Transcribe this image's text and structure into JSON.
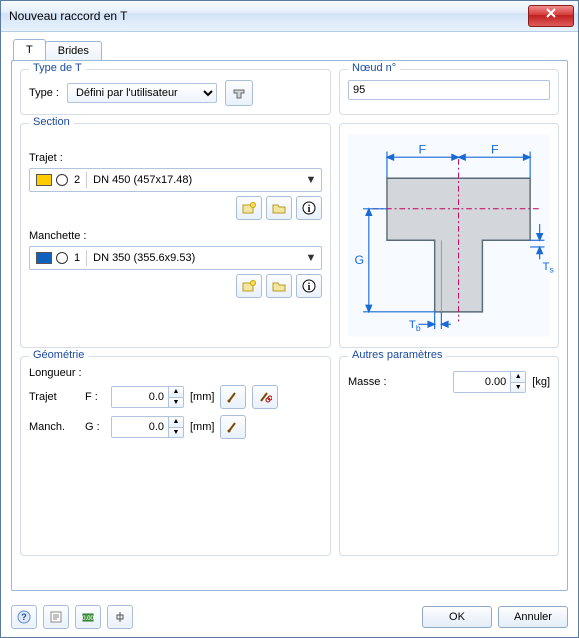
{
  "window": {
    "title": "Nouveau raccord en T"
  },
  "tabs": {
    "t": "T",
    "brides": "Brides"
  },
  "type_group": {
    "legend": "Type de T",
    "label": "Type :",
    "selected": "Défini par l'utilisateur"
  },
  "node_group": {
    "legend": "Nœud n°",
    "value": "95"
  },
  "section_group": {
    "legend": "Section",
    "trajet_label": "Trajet :",
    "trajet_idx": "2",
    "trajet_text": "DN 450 (457x17.48)",
    "manchette_label": "Manchette :",
    "manchette_idx": "1",
    "manchette_text": "DN 350 (355.6x9.53)"
  },
  "preview": {
    "F": "F",
    "G": "G",
    "Tb": "T",
    "Tb_sub": "b",
    "Ts": "T",
    "Ts_sub": "s"
  },
  "geom_group": {
    "legend": "Géométrie",
    "length_label": "Longueur :",
    "trajet_label": "Trajet",
    "trajet_sym": "F :",
    "trajet_val": "0.0",
    "manch_label": "Manch.",
    "manch_sym": "G :",
    "manch_val": "0.0",
    "unit": "[mm]"
  },
  "other_group": {
    "legend": "Autres paramètres",
    "mass_label": "Masse :",
    "mass_val": "0.00",
    "mass_unit": "[kg]"
  },
  "buttons": {
    "ok": "OK",
    "cancel": "Annuler"
  }
}
